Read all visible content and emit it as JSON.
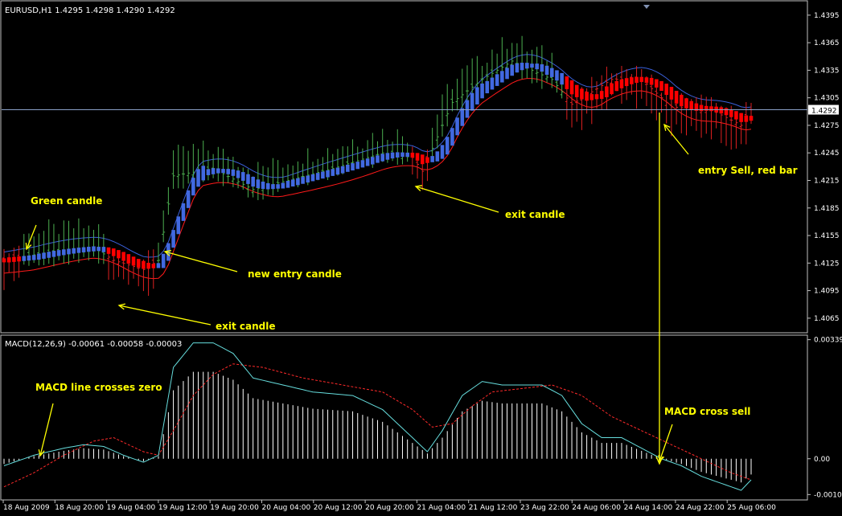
{
  "colors": {
    "background": "#000000",
    "frame": "#c0c0c0",
    "axis_text": "#ffffff",
    "bull_bar": "#4caf50",
    "bear_bar": "#e02020",
    "ma_bull": "#4169e1",
    "ma_bear": "#ff0000",
    "upper_band": "#3a5fd8",
    "lower_band": "#ff1a1a",
    "price_line": "#8aa0c8",
    "annotation": "#ffff00",
    "macd_main": "#66dddd",
    "macd_signal": "#ff2a2a",
    "macd_hist": "#ffffff"
  },
  "header": {
    "price_title": "EURUSD,H1  1.4295 1.4298 1.4290 1.4292",
    "macd_title": "MACD(12,26,9) -0.00061 -0.00058 -0.00003"
  },
  "annotations": [
    {
      "id": "green-candle",
      "text": "Green candle"
    },
    {
      "id": "new-entry",
      "text": "new entry candle"
    },
    {
      "id": "exit-1",
      "text": "exit candle"
    },
    {
      "id": "exit-2",
      "text": "exit candle"
    },
    {
      "id": "entry-sell",
      "text": "entry Sell, red bar"
    },
    {
      "id": "macd-zero",
      "text": "MACD line crosses zero"
    },
    {
      "id": "macd-cross",
      "text": "MACD cross sell"
    }
  ],
  "chart_data": [
    {
      "type": "candlestick",
      "title": "EURUSD,H1  1.4295 1.4298 1.4290 1.4292",
      "symbol": "EURUSD",
      "timeframe": "H1",
      "last": {
        "open": 1.4295,
        "high": 1.4298,
        "low": 1.429,
        "close": 1.4292
      },
      "current_price_label": "1.4292",
      "current_price": 1.4292,
      "ylim": [
        1.405,
        1.4408
      ],
      "y_ticks": [
        "1.4395",
        "1.4365",
        "1.4335",
        "1.4305",
        "1.4275",
        "1.4245",
        "1.4215",
        "1.4185",
        "1.4155",
        "1.4125",
        "1.4095",
        "1.4065"
      ],
      "x_ticks": [
        "18 Aug 2009",
        "18 Aug 20:00",
        "19 Aug 04:00",
        "19 Aug 12:00",
        "19 Aug 20:00",
        "20 Aug 04:00",
        "20 Aug 12:00",
        "20 Aug 20:00",
        "21 Aug 04:00",
        "21 Aug 12:00",
        "23 Aug 22:00",
        "24 Aug 06:00",
        "24 Aug 14:00",
        "24 Aug 22:00",
        "25 Aug 06:00"
      ],
      "key_prices": [
        {
          "x": 0,
          "price": 1.4128
        },
        {
          "x": 10,
          "price": 1.4138
        },
        {
          "x": 18,
          "price": 1.4142
        },
        {
          "x": 22,
          "price": 1.4128
        },
        {
          "x": 28,
          "price": 1.4118
        },
        {
          "x": 31,
          "price": 1.4128
        },
        {
          "x": 34,
          "price": 1.422
        },
        {
          "x": 42,
          "price": 1.4228
        },
        {
          "x": 50,
          "price": 1.4205
        },
        {
          "x": 66,
          "price": 1.4228
        },
        {
          "x": 76,
          "price": 1.4245
        },
        {
          "x": 82,
          "price": 1.424
        },
        {
          "x": 84,
          "price": 1.4225
        },
        {
          "x": 90,
          "price": 1.43
        },
        {
          "x": 96,
          "price": 1.4325
        },
        {
          "x": 102,
          "price": 1.4345
        },
        {
          "x": 110,
          "price": 1.4325
        },
        {
          "x": 114,
          "price": 1.4298
        },
        {
          "x": 122,
          "price": 1.4325
        },
        {
          "x": 128,
          "price": 1.4325
        },
        {
          "x": 134,
          "price": 1.4295
        },
        {
          "x": 142,
          "price": 1.4292
        },
        {
          "x": 148,
          "price": 1.4275
        },
        {
          "x": 150,
          "price": 1.4292
        }
      ],
      "bear_ranges": [
        [
          0,
          3
        ],
        [
          21,
          30
        ],
        [
          82,
          85
        ],
        [
          113,
          150
        ]
      ]
    },
    {
      "type": "line",
      "title": "MACD(12,26,9) -0.00061 -0.00058 -0.00003",
      "indicator": "MACD",
      "params": [
        12,
        26,
        9
      ],
      "values": {
        "main": -0.00061,
        "signal": -0.00058,
        "histogram": -3e-05
      },
      "y_ticks": [
        "0.00339",
        "0.00",
        "-0.00102"
      ],
      "ylim": [
        -0.00115,
        0.00345
      ],
      "series": [
        {
          "name": "MACD",
          "style": "solid",
          "points": [
            [
              0,
              -0.0002
            ],
            [
              6,
              0.0001
            ],
            [
              12,
              0.0003
            ],
            [
              16,
              0.0004
            ],
            [
              20,
              0.00035
            ],
            [
              24,
              0.0001
            ],
            [
              28,
              -0.0001
            ],
            [
              31,
              0.0001
            ],
            [
              34,
              0.0026
            ],
            [
              38,
              0.0033
            ],
            [
              42,
              0.0033
            ],
            [
              46,
              0.003
            ],
            [
              50,
              0.0023
            ],
            [
              56,
              0.0021
            ],
            [
              62,
              0.0019
            ],
            [
              70,
              0.0018
            ],
            [
              76,
              0.0014
            ],
            [
              82,
              0.0006
            ],
            [
              85,
              0.0002
            ],
            [
              88,
              0.0008
            ],
            [
              92,
              0.0018
            ],
            [
              96,
              0.0022
            ],
            [
              100,
              0.0021
            ],
            [
              104,
              0.0021
            ],
            [
              108,
              0.0021
            ],
            [
              112,
              0.0018
            ],
            [
              116,
              0.001
            ],
            [
              120,
              0.0006
            ],
            [
              124,
              0.0006
            ],
            [
              128,
              0.0003
            ],
            [
              132,
              0.0
            ],
            [
              136,
              -0.0002
            ],
            [
              140,
              -0.0005
            ],
            [
              144,
              -0.0007
            ],
            [
              148,
              -0.0009
            ],
            [
              150,
              -0.0006
            ]
          ]
        },
        {
          "name": "Signal",
          "style": "dashed",
          "points": [
            [
              0,
              -0.0008
            ],
            [
              6,
              -0.0004
            ],
            [
              12,
              0.0001
            ],
            [
              18,
              0.0005
            ],
            [
              22,
              0.0006
            ],
            [
              28,
              0.0002
            ],
            [
              31,
              0.0001
            ],
            [
              34,
              0.0008
            ],
            [
              38,
              0.0018
            ],
            [
              42,
              0.0024
            ],
            [
              46,
              0.0027
            ],
            [
              52,
              0.0026
            ],
            [
              60,
              0.0023
            ],
            [
              68,
              0.0021
            ],
            [
              76,
              0.0019
            ],
            [
              82,
              0.0014
            ],
            [
              86,
              0.0009
            ],
            [
              90,
              0.001
            ],
            [
              94,
              0.0015
            ],
            [
              98,
              0.0019
            ],
            [
              104,
              0.002
            ],
            [
              110,
              0.0021
            ],
            [
              116,
              0.0018
            ],
            [
              122,
              0.0012
            ],
            [
              128,
              0.0008
            ],
            [
              134,
              0.0004
            ],
            [
              140,
              0.0
            ],
            [
              146,
              -0.0004
            ],
            [
              150,
              -0.0006
            ]
          ]
        }
      ]
    }
  ]
}
